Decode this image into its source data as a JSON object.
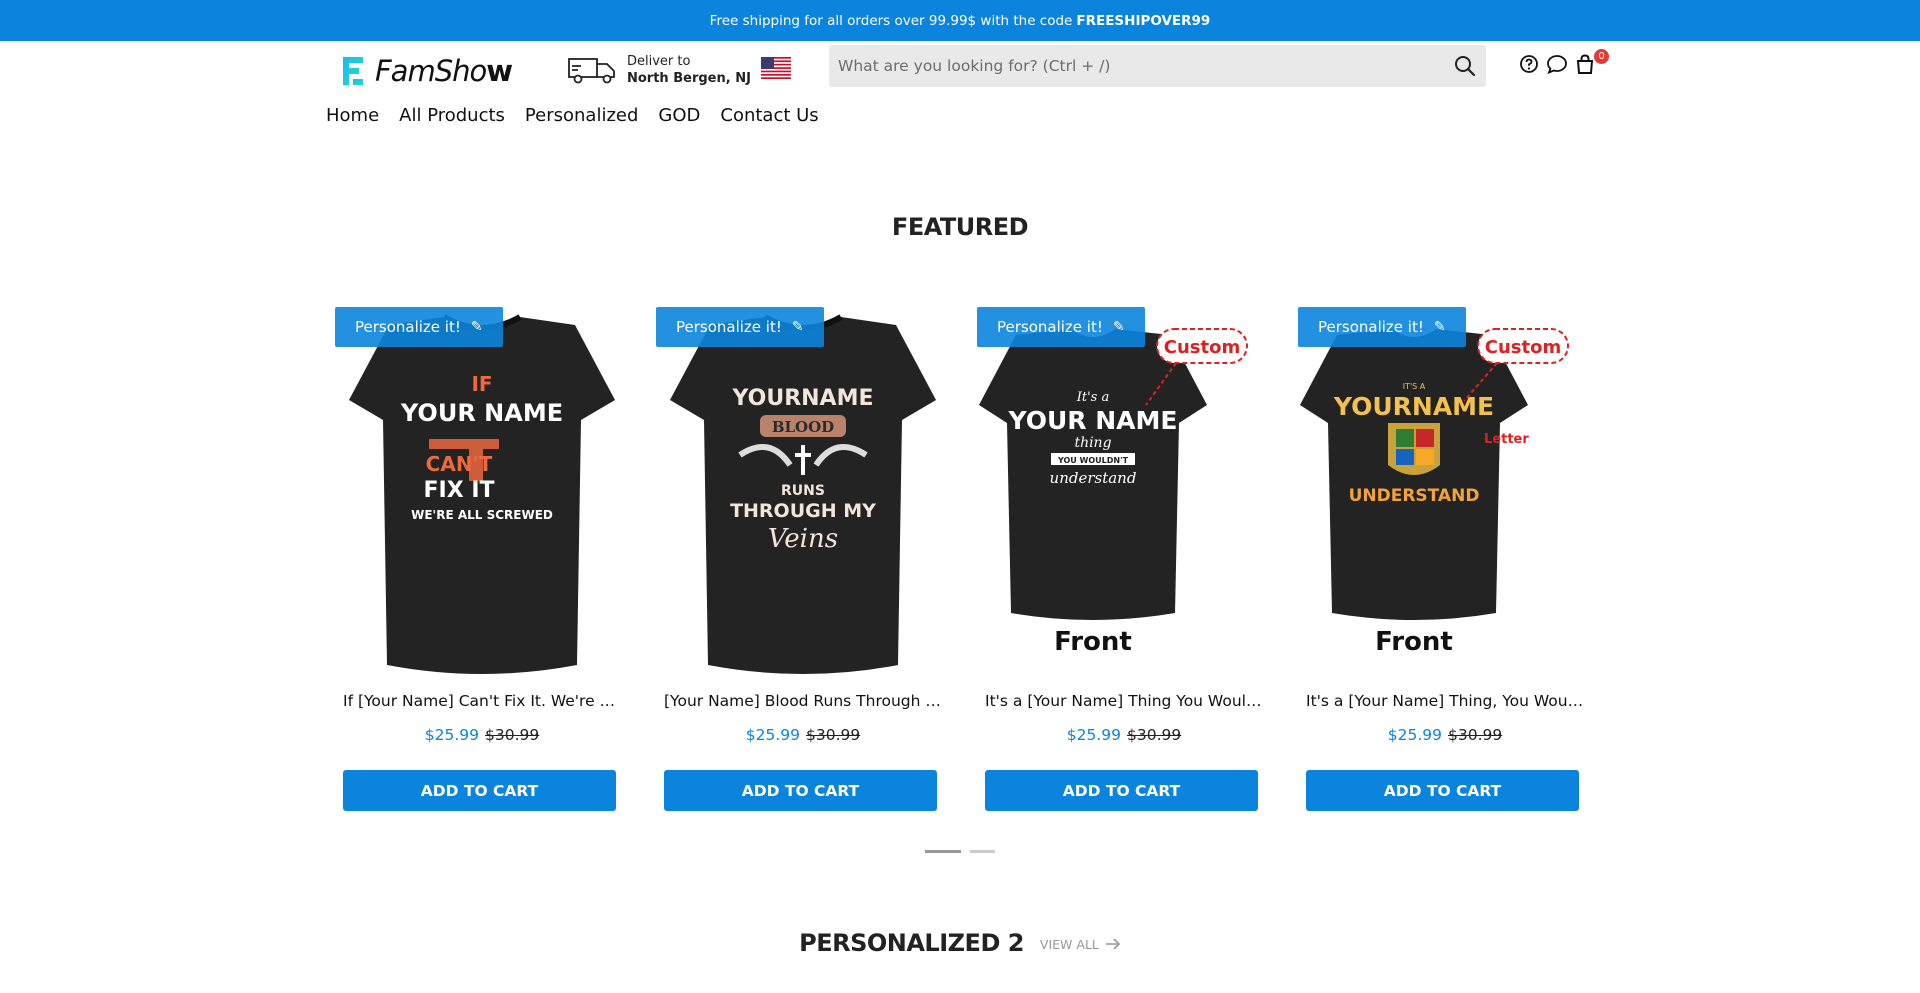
{
  "announcement": {
    "text": "Free shipping for all orders over 99.99$ with the code",
    "code": "FREESHIPOVER99"
  },
  "header": {
    "logo_text_main": "FamSho",
    "logo_text_end": "w",
    "deliver_label": "Deliver to",
    "deliver_location": "North Bergen, NJ",
    "search_placeholder": "What are you looking for? (Ctrl + /)",
    "cart_count": "0"
  },
  "nav": [
    "Home",
    "All Products",
    "Personalized",
    "GOD",
    "Contact Us"
  ],
  "featured": {
    "title": "FEATURED",
    "personalize_label": "Personalize it!",
    "add_to_cart_label": "ADD TO CART",
    "products": [
      {
        "name": "If [Your Name] Can't Fix It. We're All Screwed",
        "price": "$25.99",
        "compare_price": "$30.99",
        "shirt_text": [
          "IF",
          "YOUR NAME",
          "CAN'T",
          "FIX IT",
          "WE'RE ALL SCREWED"
        ]
      },
      {
        "name": "[Your Name] Blood Runs Through My Veins",
        "price": "$25.99",
        "compare_price": "$30.99",
        "shirt_text": [
          "YOURNAME",
          "BLOOD",
          "RUNS",
          "THROUGH MY",
          "Veins"
        ]
      },
      {
        "name": "It's a [Your Name] Thing You Wouldn't Understand",
        "price": "$25.99",
        "compare_price": "$30.99",
        "shirt_text": [
          "It's a",
          "YOUR NAME",
          "thing",
          "YOU WOULDN'T",
          "understand"
        ],
        "callout": "Custom",
        "caption": "Front"
      },
      {
        "name": "It's a [Your Name] Thing, You Wouldn't Understand",
        "price": "$25.99",
        "compare_price": "$30.99",
        "shirt_text": [
          "IT'S A",
          "YOURNAME",
          "UNDERSTAND"
        ],
        "callout": "Custom",
        "callout2": "Letter",
        "caption": "Front"
      }
    ]
  },
  "personalized2": {
    "title": "PERSONALIZED 2",
    "view_all": "VIEW ALL"
  },
  "colors": {
    "brand_blue": "#0b84dd",
    "badge_red": "#e53935"
  }
}
